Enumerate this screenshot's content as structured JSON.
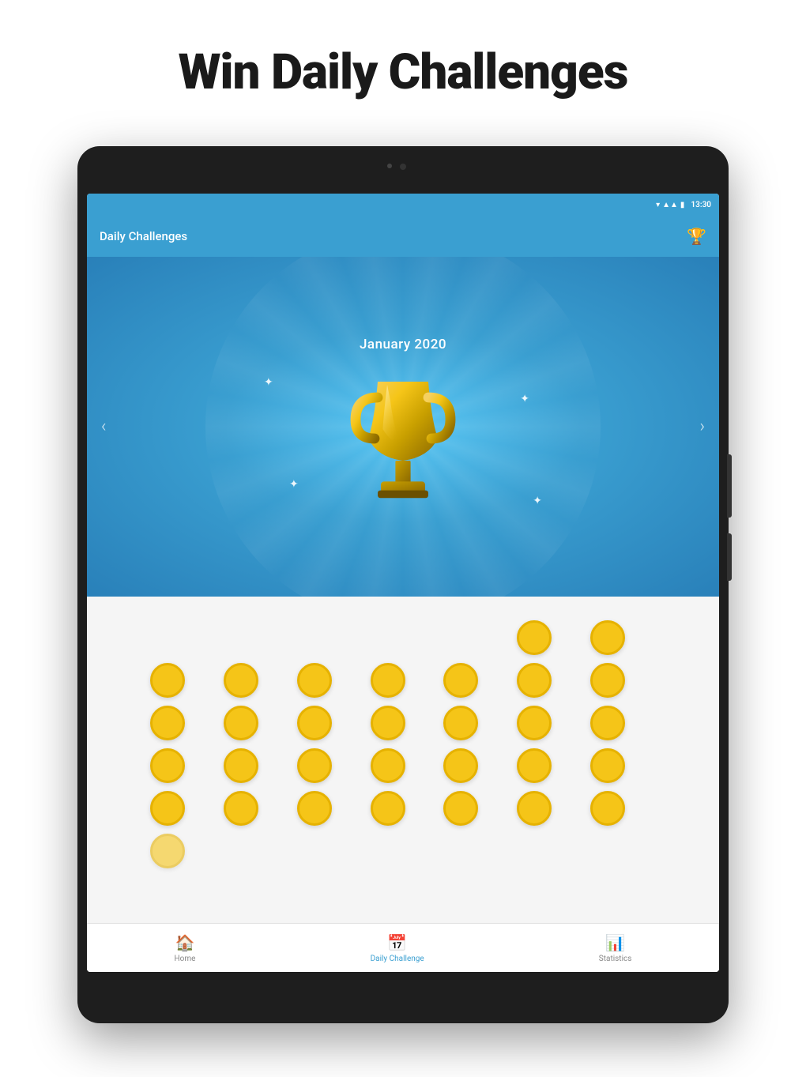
{
  "page": {
    "title": "Win Daily Challenges"
  },
  "app": {
    "bar_title": "Daily Challenges",
    "trophy_icon": "🏆",
    "month": "January 2020",
    "status_time": "13:30"
  },
  "nav": {
    "left_arrow": "‹",
    "right_arrow": "›",
    "items": [
      {
        "id": "home",
        "label": "Home",
        "icon": "🏠",
        "active": false
      },
      {
        "id": "daily",
        "label": "Daily Challenge",
        "icon": "📅",
        "active": true
      },
      {
        "id": "stats",
        "label": "Statistics",
        "icon": "📊",
        "active": false
      }
    ]
  },
  "calendar": {
    "rows": [
      [
        false,
        false,
        false,
        false,
        false,
        true,
        true
      ],
      [
        true,
        true,
        true,
        true,
        true,
        true,
        true
      ],
      [
        true,
        true,
        true,
        true,
        true,
        true,
        true
      ],
      [
        true,
        true,
        true,
        true,
        true,
        true,
        true
      ],
      [
        true,
        true,
        true,
        true,
        true,
        true,
        true
      ],
      [
        "current",
        false,
        false,
        false,
        false,
        false,
        false
      ]
    ]
  }
}
